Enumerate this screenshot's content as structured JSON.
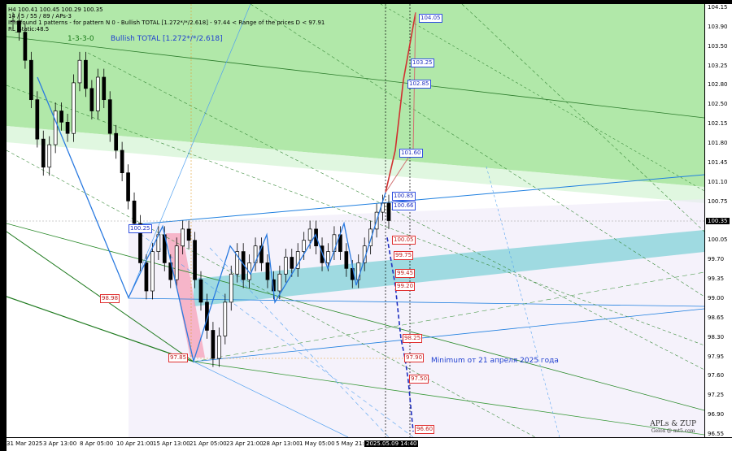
{
  "header": {
    "symbol_line": "H4  100.41 100.45 100.29 100.35",
    "line2": "14 / 5 / 55 / 89 / APs-3",
    "line3": "It is found 1 patterns  -  for pattern N 0 - Bullish TOTAL [1.272*/*/2.618] - 97.44 < Range of the prices D < 97.91",
    "line4": "RL_Static:48.5",
    "pattern_code": "1-3-3-0",
    "pattern_name": "Bullish TOTAL [1.272*/*/2.618]"
  },
  "price_axis": {
    "labels": [
      "104.15",
      "103.90",
      "103.50",
      "103.25",
      "102.80",
      "102.50",
      "102.15",
      "101.80",
      "101.45",
      "101.10",
      "100.75",
      "100.35",
      "100.05",
      "99.70",
      "99.35",
      "99.00",
      "98.65",
      "98.30",
      "97.95",
      "97.60",
      "97.25",
      "96.90",
      "96.55"
    ],
    "current": "100.35"
  },
  "time_axis": {
    "labels": [
      "31 Mar 2025",
      "3 Apr 13:00",
      "8 Apr 05:00",
      "10 Apr 21:00",
      "15 Apr 13:00",
      "21 Apr 05:00",
      "23 Apr 21:00",
      "28 Apr 13:00",
      "1 May 05:00",
      "5 May 21:00"
    ],
    "current": "2025.05.09 14:40"
  },
  "levels_blue": [
    "104.05",
    "103.25",
    "102.85",
    "101.60",
    "100.85",
    "100.66",
    "100.25"
  ],
  "levels_red": [
    "100.05",
    "99.75",
    "99.45",
    "99.20",
    "98.98",
    "98.25",
    "97.90",
    "97.85",
    "97.50",
    "96.60"
  ],
  "annotation": "Minimum от 21 апреля 2025 года",
  "brand": {
    "name": "APLs & ZUP",
    "sub": "Gelox @ mt5.com"
  },
  "chart_data": {
    "type": "candlestick",
    "timeframe": "H4",
    "ylim": [
      96.5,
      104.2
    ],
    "ohlc_last": {
      "open": 100.41,
      "high": 100.45,
      "low": 100.29,
      "close": 100.35
    },
    "close_path": [
      103.9,
      103.7,
      103.2,
      102.5,
      101.8,
      101.3,
      101.7,
      102.3,
      102.1,
      101.9,
      102.8,
      103.2,
      102.7,
      102.3,
      102.9,
      102.5,
      101.9,
      101.6,
      101.2,
      100.7,
      100.3,
      99.6,
      99.1,
      99.8,
      100.1,
      99.6,
      99.3,
      99.9,
      100.2,
      100.0,
      99.3,
      98.9,
      98.4,
      97.9,
      98.3,
      98.9,
      99.4,
      99.8,
      99.3,
      99.6,
      99.9,
      99.6,
      99.3,
      99.1,
      99.4,
      99.7,
      99.5,
      99.8,
      100.0,
      100.2,
      99.9,
      99.6,
      99.8,
      100.1,
      99.8,
      99.5,
      99.3,
      99.6,
      99.9,
      100.2,
      100.5,
      100.66,
      100.35
    ],
    "zigzag": [
      102.9,
      98.98,
      100.25,
      97.85,
      99.9,
      99.4,
      100.1,
      98.9,
      100.1,
      99.5,
      100.3,
      99.2,
      100.85
    ],
    "projection_up": [
      100.85,
      101.6,
      102.85,
      104.05
    ],
    "projection_down": [
      100.05,
      99.2,
      98.25,
      97.9,
      97.5,
      96.6
    ]
  }
}
